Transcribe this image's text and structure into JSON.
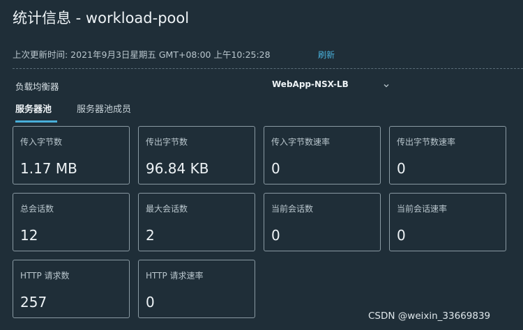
{
  "page": {
    "title": "统计信息 - workload-pool",
    "last_updated": "上次更新时间: 2021年9月3日星期五 GMT+08:00 上午10:25:28",
    "refresh_label": "刷新"
  },
  "load_balancer": {
    "label": "负载均衡器",
    "selected": "WebApp-NSX-LB"
  },
  "tabs": [
    {
      "label": "服务器池",
      "active": true
    },
    {
      "label": "服务器池成员",
      "active": false
    }
  ],
  "stats": [
    {
      "label": "传入字节数",
      "value": "1.17 MB"
    },
    {
      "label": "传出字节数",
      "value": "96.84 KB"
    },
    {
      "label": "传入字节数速率",
      "value": "0"
    },
    {
      "label": "传出字节数速率",
      "value": "0"
    },
    {
      "label": "总会话数",
      "value": "12"
    },
    {
      "label": "最大会话数",
      "value": "2"
    },
    {
      "label": "当前会话数",
      "value": "0"
    },
    {
      "label": "当前会话速率",
      "value": "0"
    },
    {
      "label": "HTTP 请求数",
      "value": "257"
    },
    {
      "label": "HTTP 请求速率",
      "value": "0"
    }
  ],
  "watermark": "CSDN @weixin_33669839",
  "colors": {
    "background": "#1f2e38",
    "accent": "#49afd9",
    "card_border": "#8a9aa3"
  }
}
